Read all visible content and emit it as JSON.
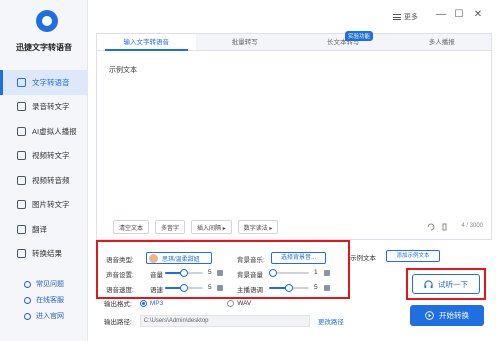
{
  "app": {
    "title": "迅捷文字转语音"
  },
  "titlebar": {
    "menu_label": "更多",
    "minimize": "—",
    "maximize": "☐",
    "close": "✕"
  },
  "sidebar": {
    "items": [
      {
        "label": "文字转语音",
        "icon": "speech-icon",
        "active": true
      },
      {
        "label": "录音转文字",
        "icon": "record-icon"
      },
      {
        "label": "AI虚拟人播报",
        "icon": "avatar-icon"
      },
      {
        "label": "视频转文字",
        "icon": "video-icon"
      },
      {
        "label": "视频转音频",
        "icon": "video-audio-icon"
      },
      {
        "label": "图片转文字",
        "icon": "image-icon"
      },
      {
        "label": "翻译",
        "icon": "translate-icon"
      },
      {
        "label": "转换结果",
        "icon": "result-icon"
      }
    ],
    "links": [
      {
        "label": "常见问题",
        "icon": "question-icon"
      },
      {
        "label": "在线客服",
        "icon": "support-icon"
      },
      {
        "label": "进入官网",
        "icon": "website-icon"
      }
    ]
  },
  "tabs": [
    {
      "label": "输入文字转语音",
      "active": true
    },
    {
      "label": "批量转写"
    },
    {
      "label": "长文本转写"
    },
    {
      "label": "多人播报"
    }
  ],
  "beta_badge": "实验功能",
  "editor": {
    "text": "示例文本",
    "char_count": "4 / 3000"
  },
  "editor_toolbar": {
    "clear": "清空文本",
    "polyphone": "多音字",
    "insert_pause": "插入间隔 ▸",
    "number_reading": "数字读法 ▸"
  },
  "settings": {
    "voice_type_label": "语音类型:",
    "voice_name": "思琪/温柔甜妞",
    "bgm_label": "背景音乐:",
    "bgm_button": "选择背景音...",
    "sound_label": "声音设置:",
    "volume_label": "音量",
    "volume_value": "5",
    "volume_level": 0.5,
    "bg_volume_label": "背景音量",
    "bg_volume_value": "1",
    "bg_volume_level": 0.1,
    "speed_label": "语音速度:",
    "speed_sub_label": "语速",
    "speed_value": "5",
    "speed_level": 0.5,
    "pitch_label": "主播语调",
    "pitch_value": "5",
    "pitch_level": 0.5
  },
  "sample": {
    "label": "示例文本",
    "add_button": "添加示例文本"
  },
  "output": {
    "format_label": "输出格式:",
    "format_mp3": "MP3",
    "format_wav": "WAV",
    "path_label": "输出路径:",
    "path_value": "C:\\Users\\Admin\\desktop",
    "change_path": "更改路径"
  },
  "actions": {
    "try_listen": "试听一下",
    "start_convert": "开始转换"
  },
  "colors": {
    "accent": "#1f6fe0",
    "highlight": "#e3161b"
  }
}
